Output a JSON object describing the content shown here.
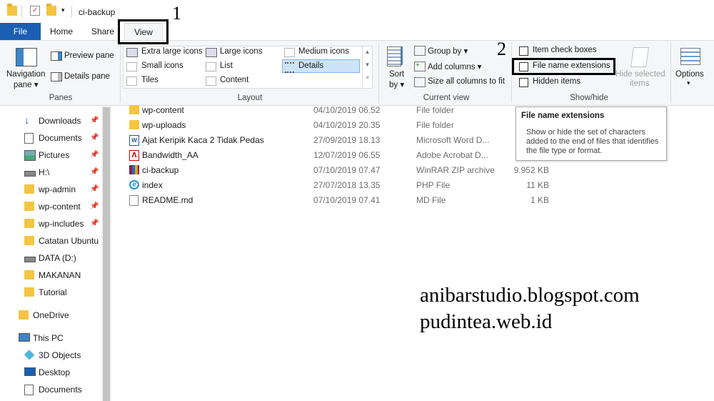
{
  "window": {
    "title": "ci-backup"
  },
  "colors": {
    "file_tab": "#1a5fb4",
    "selected": "#cce4f7"
  },
  "tabs": [
    {
      "label": "File"
    },
    {
      "label": "Home"
    },
    {
      "label": "Share"
    },
    {
      "label": "View"
    }
  ],
  "ribbon": {
    "panes": {
      "navigation_line1": "Navigation",
      "navigation_line2": "pane",
      "preview": "Preview pane",
      "details": "Details pane",
      "label": "Panes"
    },
    "layout": {
      "items": [
        "Extra large icons",
        "Large icons",
        "Medium icons",
        "Small icons",
        "List",
        "Details",
        "Tiles",
        "Content"
      ],
      "selected": "Details",
      "label": "Layout"
    },
    "current_view": {
      "sort_line1": "Sort",
      "sort_line2": "by",
      "group_by": "Group by",
      "add_columns": "Add columns",
      "size_columns": "Size all columns to fit",
      "label": "Current view"
    },
    "show_hide": {
      "item_check_boxes": "Item check boxes",
      "file_name_extensions": "File name extensions",
      "hidden_items": "Hidden items",
      "hide_selected_line1": "Hide selected",
      "hide_selected_line2": "items",
      "label": "Show/hide"
    },
    "options": {
      "label": "Options"
    }
  },
  "tooltip": {
    "title": "File name extensions",
    "body": "Show or hide the set of characters added to the end of files that identifies the file type or format."
  },
  "nav": [
    {
      "label": "Downloads",
      "icon": "download-icon",
      "pinned": true
    },
    {
      "label": "Documents",
      "icon": "document-icon",
      "pinned": true
    },
    {
      "label": "Pictures",
      "icon": "pictures-icon",
      "pinned": true
    },
    {
      "label": "H:\\",
      "icon": "drive-icon",
      "pinned": true
    },
    {
      "label": "wp-admin",
      "icon": "folder-icon",
      "pinned": true
    },
    {
      "label": "wp-content",
      "icon": "folder-icon",
      "pinned": true
    },
    {
      "label": "wp-includes",
      "icon": "folder-icon",
      "pinned": true
    },
    {
      "label": "Catatan Ubuntu",
      "icon": "folder-icon",
      "pinned": false
    },
    {
      "label": "DATA (D:)",
      "icon": "drive-icon",
      "pinned": false
    },
    {
      "label": "MAKANAN",
      "icon": "folder-icon",
      "pinned": false
    },
    {
      "label": "Tutorial",
      "icon": "folder-icon",
      "pinned": false
    },
    {
      "label": "OneDrive",
      "icon": "folder-icon",
      "pinned": false
    },
    {
      "label": "This PC",
      "icon": "computer-icon",
      "pinned": false
    },
    {
      "label": "3D Objects",
      "icon": "cube-icon",
      "pinned": false
    },
    {
      "label": "Desktop",
      "icon": "desktop-icon",
      "pinned": false
    },
    {
      "label": "Documents",
      "icon": "document-icon",
      "pinned": false
    }
  ],
  "files": [
    {
      "name": "wp-content",
      "date": "04/10/2019 06.52",
      "type": "File folder",
      "size": "",
      "icon": "folder-icon"
    },
    {
      "name": "wp-uploads",
      "date": "04/10/2019 20.35",
      "type": "File folder",
      "size": "",
      "icon": "folder-icon"
    },
    {
      "name": "Ajat Keripik Kaca 2 Tidak Pedas",
      "date": "27/09/2019 18.13",
      "type": "Microsoft Word D...",
      "size": "",
      "icon": "word-icon"
    },
    {
      "name": "Bandwidth_AA",
      "date": "12/07/2019 06.55",
      "type": "Adobe Acrobat D...",
      "size": "",
      "icon": "pdf-icon"
    },
    {
      "name": "ci-backup",
      "date": "07/10/2019 07.47",
      "type": "WinRAR ZIP archive",
      "size": "9.952 KB",
      "icon": "winrar-icon"
    },
    {
      "name": "index",
      "date": "27/07/2018 13.35",
      "type": "PHP File",
      "size": "11 KB",
      "icon": "ie-icon"
    },
    {
      "name": "README.md",
      "date": "07/10/2019 07.41",
      "type": "MD File",
      "size": "1 KB",
      "icon": "file-icon"
    }
  ],
  "annotations": {
    "one": "1",
    "two": "2"
  },
  "watermark": {
    "line1": "anibarstudio.blogspot.com",
    "line2": "pudintea.web.id"
  }
}
